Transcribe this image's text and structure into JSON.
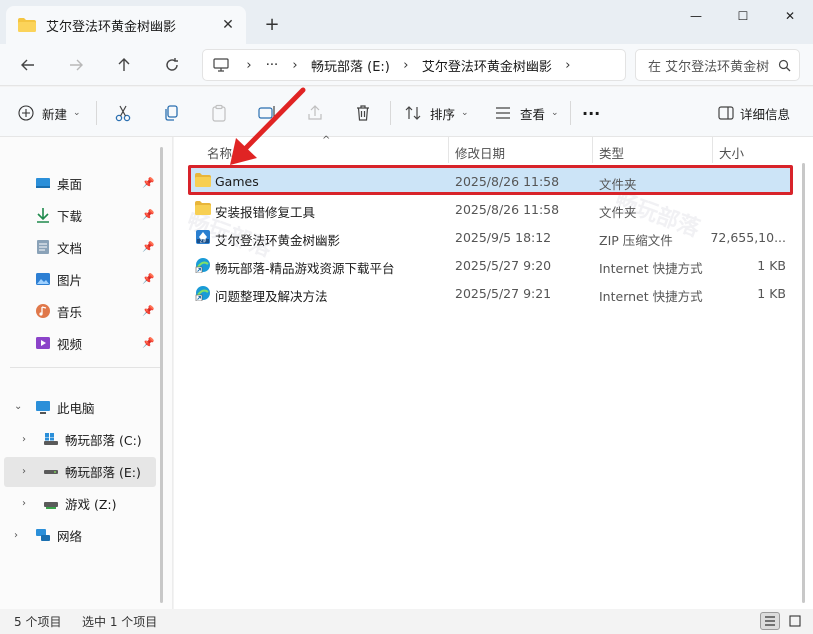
{
  "window": {
    "tab_title": "艾尔登法环黄金树幽影",
    "tab_close": "✕",
    "new_tab": "+",
    "minimize": "—",
    "maximize": "☐",
    "close": "✕"
  },
  "address": {
    "ellipsis": "···",
    "breadcrumbs": [
      "畅玩部落 (E:)",
      "艾尔登法环黄金树幽影"
    ],
    "sep": "›",
    "search_placeholder": "在 艾尔登法环黄金树幽影 中搜索"
  },
  "toolbar": {
    "new_label": "新建",
    "sort_label": "排序",
    "view_label": "查看",
    "more_label": "···",
    "details_label": "详细信息"
  },
  "sidebar": {
    "quick": [
      {
        "label": "桌面",
        "icon": "desktop-icon"
      },
      {
        "label": "下载",
        "icon": "download-icon"
      },
      {
        "label": "文档",
        "icon": "document-icon"
      },
      {
        "label": "图片",
        "icon": "pictures-icon"
      },
      {
        "label": "音乐",
        "icon": "music-icon"
      },
      {
        "label": "视频",
        "icon": "video-icon"
      }
    ],
    "this_pc": "此电脑",
    "drives": [
      {
        "label": "畅玩部落 (C:)"
      },
      {
        "label": "畅玩部落 (E:)"
      },
      {
        "label": "游戏 (Z:)"
      }
    ],
    "network": "网络"
  },
  "columns": {
    "name": "名称",
    "date": "修改日期",
    "type": "类型",
    "size": "大小"
  },
  "files": [
    {
      "name": "Games",
      "date": "2025/8/26 11:58",
      "type": "文件夹",
      "size": "",
      "icon": "folder-icon"
    },
    {
      "name": "安装报错修复工具",
      "date": "2025/8/26 11:58",
      "type": "文件夹",
      "size": "",
      "icon": "folder-icon"
    },
    {
      "name": "艾尔登法环黄金树幽影",
      "date": "2025/9/5 18:12",
      "type": "ZIP 压缩文件",
      "size": "72,655,10...",
      "icon": "zip-icon"
    },
    {
      "name": "畅玩部落-精品游戏资源下载平台",
      "date": "2025/5/27 9:20",
      "type": "Internet 快捷方式",
      "size": "1 KB",
      "icon": "internet-shortcut-icon"
    },
    {
      "name": "问题整理及解决方法",
      "date": "2025/5/27 9:21",
      "type": "Internet 快捷方式",
      "size": "1 KB",
      "icon": "internet-shortcut-icon"
    }
  ],
  "status": {
    "count": "5 个项目",
    "selected": "选中 1 个项目"
  },
  "watermark": "畅玩部落",
  "colors": {
    "accent": "#0067c0",
    "highlight": "#d8232a",
    "folder": "#f4c542",
    "selection": "#cce4f7"
  }
}
